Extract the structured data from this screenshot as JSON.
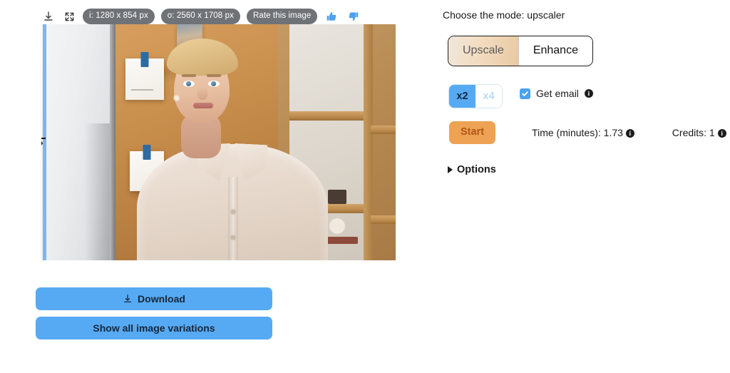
{
  "image_toolbar": {
    "download_icon": "download-icon",
    "fullscreen_icon": "fullscreen-icon",
    "input_size_badge": "i: 1280 x 854 px",
    "output_size_badge": "o: 2560 x 1708 px",
    "rate_button": "Rate this image",
    "thumbs_up_icon": "thumbs-up-icon",
    "thumbs_down_icon": "thumbs-down-icon"
  },
  "viewer": {
    "compare_handle_glyph": "›",
    "alt": "Portrait photo of a blonde woman in a beige blouse in front of a cork board and wooden shelves"
  },
  "actions": {
    "download_label": "Download",
    "download_icon": "download-icon",
    "variations_label": "Show all image variations"
  },
  "panel": {
    "mode_label": "Choose the mode: upscaler",
    "mode_options": [
      {
        "label": "Upscale",
        "selected": true
      },
      {
        "label": "Enhance",
        "selected": false
      }
    ],
    "scale_options": [
      {
        "label": "x2",
        "selected": true
      },
      {
        "label": "x4",
        "selected": false
      }
    ],
    "get_email_label": "Get email",
    "get_email_checked": true,
    "check_icon": "check-icon",
    "info_icon_glyph": "i",
    "start_label": "Start",
    "time_label": "Time (minutes): 1.73",
    "credits_label": "Credits: 1",
    "options_label": "Options",
    "options_caret_icon": "caret-right-icon"
  },
  "colors": {
    "accent_blue": "#56aaf3",
    "start_orange": "#eda254",
    "badge_gray": "#6f7378",
    "selected_tan": "#f2dcc0"
  }
}
